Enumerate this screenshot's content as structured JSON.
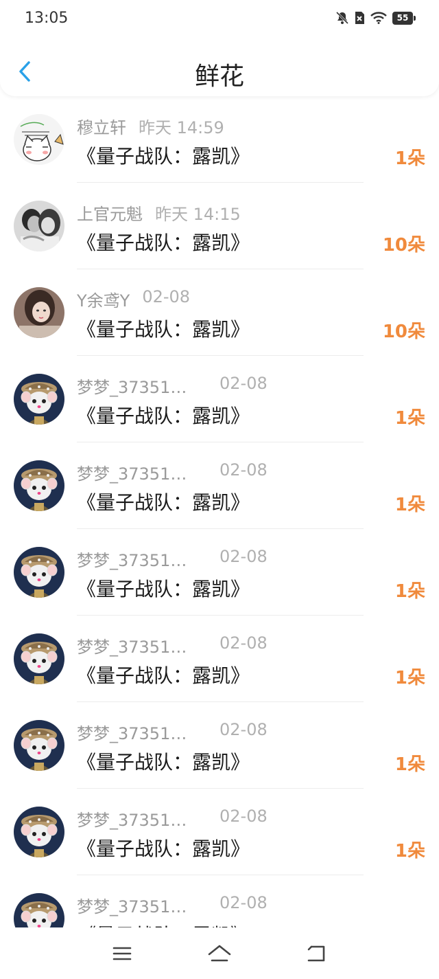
{
  "status_bar": {
    "time": "13:05",
    "battery": "55"
  },
  "header": {
    "title": "鲜花"
  },
  "colors": {
    "accent": "#2aa1e8",
    "count": "#f08a3c",
    "name": "#9a9a9a"
  },
  "items": [
    {
      "name": "穆立轩",
      "time": "昨天 14:59",
      "book": "《量子战队：露凯》",
      "count": "1朵",
      "avatar": "cat-cartoon"
    },
    {
      "name": "上官元魁",
      "time": "昨天 14:15",
      "book": "《量子战队：露凯》",
      "count": "10朵",
      "avatar": "couple-photo"
    },
    {
      "name": "Y余鸢Y",
      "time": "02-08",
      "book": "《量子战队：露凯》",
      "count": "10朵",
      "avatar": "girl-photo"
    },
    {
      "name": "梦梦_37351…",
      "time": "02-08",
      "book": "《量子战队：露凯》",
      "count": "1朵",
      "avatar": "mouse-hat"
    },
    {
      "name": "梦梦_37351…",
      "time": "02-08",
      "book": "《量子战队：露凯》",
      "count": "1朵",
      "avatar": "mouse-hat"
    },
    {
      "name": "梦梦_37351…",
      "time": "02-08",
      "book": "《量子战队：露凯》",
      "count": "1朵",
      "avatar": "mouse-hat"
    },
    {
      "name": "梦梦_37351…",
      "time": "02-08",
      "book": "《量子战队：露凯》",
      "count": "1朵",
      "avatar": "mouse-hat"
    },
    {
      "name": "梦梦_37351…",
      "time": "02-08",
      "book": "《量子战队：露凯》",
      "count": "1朵",
      "avatar": "mouse-hat"
    },
    {
      "name": "梦梦_37351…",
      "time": "02-08",
      "book": "《量子战队：露凯》",
      "count": "1朵",
      "avatar": "mouse-hat"
    },
    {
      "name": "梦梦_37351…",
      "time": "02-08",
      "book": "《量子战队：露凯》",
      "count": "",
      "avatar": "mouse-hat"
    }
  ],
  "nav": {
    "menu": "menu-icon",
    "home": "home-icon",
    "back": "back-icon"
  }
}
